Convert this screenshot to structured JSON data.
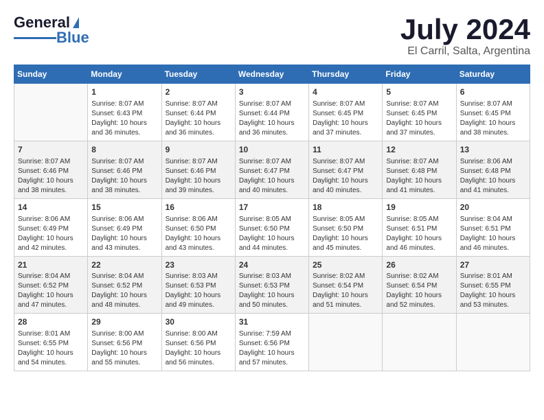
{
  "header": {
    "logo_general": "General",
    "logo_blue": "Blue",
    "month": "July 2024",
    "location": "El Carril, Salta, Argentina"
  },
  "weekdays": [
    "Sunday",
    "Monday",
    "Tuesday",
    "Wednesday",
    "Thursday",
    "Friday",
    "Saturday"
  ],
  "weeks": [
    [
      {
        "day": "",
        "sunrise": "",
        "sunset": "",
        "daylight": ""
      },
      {
        "day": "1",
        "sunrise": "Sunrise: 8:07 AM",
        "sunset": "Sunset: 6:43 PM",
        "daylight": "Daylight: 10 hours and 36 minutes."
      },
      {
        "day": "2",
        "sunrise": "Sunrise: 8:07 AM",
        "sunset": "Sunset: 6:44 PM",
        "daylight": "Daylight: 10 hours and 36 minutes."
      },
      {
        "day": "3",
        "sunrise": "Sunrise: 8:07 AM",
        "sunset": "Sunset: 6:44 PM",
        "daylight": "Daylight: 10 hours and 36 minutes."
      },
      {
        "day": "4",
        "sunrise": "Sunrise: 8:07 AM",
        "sunset": "Sunset: 6:45 PM",
        "daylight": "Daylight: 10 hours and 37 minutes."
      },
      {
        "day": "5",
        "sunrise": "Sunrise: 8:07 AM",
        "sunset": "Sunset: 6:45 PM",
        "daylight": "Daylight: 10 hours and 37 minutes."
      },
      {
        "day": "6",
        "sunrise": "Sunrise: 8:07 AM",
        "sunset": "Sunset: 6:45 PM",
        "daylight": "Daylight: 10 hours and 38 minutes."
      }
    ],
    [
      {
        "day": "7",
        "sunrise": "Sunrise: 8:07 AM",
        "sunset": "Sunset: 6:46 PM",
        "daylight": "Daylight: 10 hours and 38 minutes."
      },
      {
        "day": "8",
        "sunrise": "Sunrise: 8:07 AM",
        "sunset": "Sunset: 6:46 PM",
        "daylight": "Daylight: 10 hours and 38 minutes."
      },
      {
        "day": "9",
        "sunrise": "Sunrise: 8:07 AM",
        "sunset": "Sunset: 6:46 PM",
        "daylight": "Daylight: 10 hours and 39 minutes."
      },
      {
        "day": "10",
        "sunrise": "Sunrise: 8:07 AM",
        "sunset": "Sunset: 6:47 PM",
        "daylight": "Daylight: 10 hours and 40 minutes."
      },
      {
        "day": "11",
        "sunrise": "Sunrise: 8:07 AM",
        "sunset": "Sunset: 6:47 PM",
        "daylight": "Daylight: 10 hours and 40 minutes."
      },
      {
        "day": "12",
        "sunrise": "Sunrise: 8:07 AM",
        "sunset": "Sunset: 6:48 PM",
        "daylight": "Daylight: 10 hours and 41 minutes."
      },
      {
        "day": "13",
        "sunrise": "Sunrise: 8:06 AM",
        "sunset": "Sunset: 6:48 PM",
        "daylight": "Daylight: 10 hours and 41 minutes."
      }
    ],
    [
      {
        "day": "14",
        "sunrise": "Sunrise: 8:06 AM",
        "sunset": "Sunset: 6:49 PM",
        "daylight": "Daylight: 10 hours and 42 minutes."
      },
      {
        "day": "15",
        "sunrise": "Sunrise: 8:06 AM",
        "sunset": "Sunset: 6:49 PM",
        "daylight": "Daylight: 10 hours and 43 minutes."
      },
      {
        "day": "16",
        "sunrise": "Sunrise: 8:06 AM",
        "sunset": "Sunset: 6:50 PM",
        "daylight": "Daylight: 10 hours and 43 minutes."
      },
      {
        "day": "17",
        "sunrise": "Sunrise: 8:05 AM",
        "sunset": "Sunset: 6:50 PM",
        "daylight": "Daylight: 10 hours and 44 minutes."
      },
      {
        "day": "18",
        "sunrise": "Sunrise: 8:05 AM",
        "sunset": "Sunset: 6:50 PM",
        "daylight": "Daylight: 10 hours and 45 minutes."
      },
      {
        "day": "19",
        "sunrise": "Sunrise: 8:05 AM",
        "sunset": "Sunset: 6:51 PM",
        "daylight": "Daylight: 10 hours and 46 minutes."
      },
      {
        "day": "20",
        "sunrise": "Sunrise: 8:04 AM",
        "sunset": "Sunset: 6:51 PM",
        "daylight": "Daylight: 10 hours and 46 minutes."
      }
    ],
    [
      {
        "day": "21",
        "sunrise": "Sunrise: 8:04 AM",
        "sunset": "Sunset: 6:52 PM",
        "daylight": "Daylight: 10 hours and 47 minutes."
      },
      {
        "day": "22",
        "sunrise": "Sunrise: 8:04 AM",
        "sunset": "Sunset: 6:52 PM",
        "daylight": "Daylight: 10 hours and 48 minutes."
      },
      {
        "day": "23",
        "sunrise": "Sunrise: 8:03 AM",
        "sunset": "Sunset: 6:53 PM",
        "daylight": "Daylight: 10 hours and 49 minutes."
      },
      {
        "day": "24",
        "sunrise": "Sunrise: 8:03 AM",
        "sunset": "Sunset: 6:53 PM",
        "daylight": "Daylight: 10 hours and 50 minutes."
      },
      {
        "day": "25",
        "sunrise": "Sunrise: 8:02 AM",
        "sunset": "Sunset: 6:54 PM",
        "daylight": "Daylight: 10 hours and 51 minutes."
      },
      {
        "day": "26",
        "sunrise": "Sunrise: 8:02 AM",
        "sunset": "Sunset: 6:54 PM",
        "daylight": "Daylight: 10 hours and 52 minutes."
      },
      {
        "day": "27",
        "sunrise": "Sunrise: 8:01 AM",
        "sunset": "Sunset: 6:55 PM",
        "daylight": "Daylight: 10 hours and 53 minutes."
      }
    ],
    [
      {
        "day": "28",
        "sunrise": "Sunrise: 8:01 AM",
        "sunset": "Sunset: 6:55 PM",
        "daylight": "Daylight: 10 hours and 54 minutes."
      },
      {
        "day": "29",
        "sunrise": "Sunrise: 8:00 AM",
        "sunset": "Sunset: 6:56 PM",
        "daylight": "Daylight: 10 hours and 55 minutes."
      },
      {
        "day": "30",
        "sunrise": "Sunrise: 8:00 AM",
        "sunset": "Sunset: 6:56 PM",
        "daylight": "Daylight: 10 hours and 56 minutes."
      },
      {
        "day": "31",
        "sunrise": "Sunrise: 7:59 AM",
        "sunset": "Sunset: 6:56 PM",
        "daylight": "Daylight: 10 hours and 57 minutes."
      },
      {
        "day": "",
        "sunrise": "",
        "sunset": "",
        "daylight": ""
      },
      {
        "day": "",
        "sunrise": "",
        "sunset": "",
        "daylight": ""
      },
      {
        "day": "",
        "sunrise": "",
        "sunset": "",
        "daylight": ""
      }
    ]
  ]
}
